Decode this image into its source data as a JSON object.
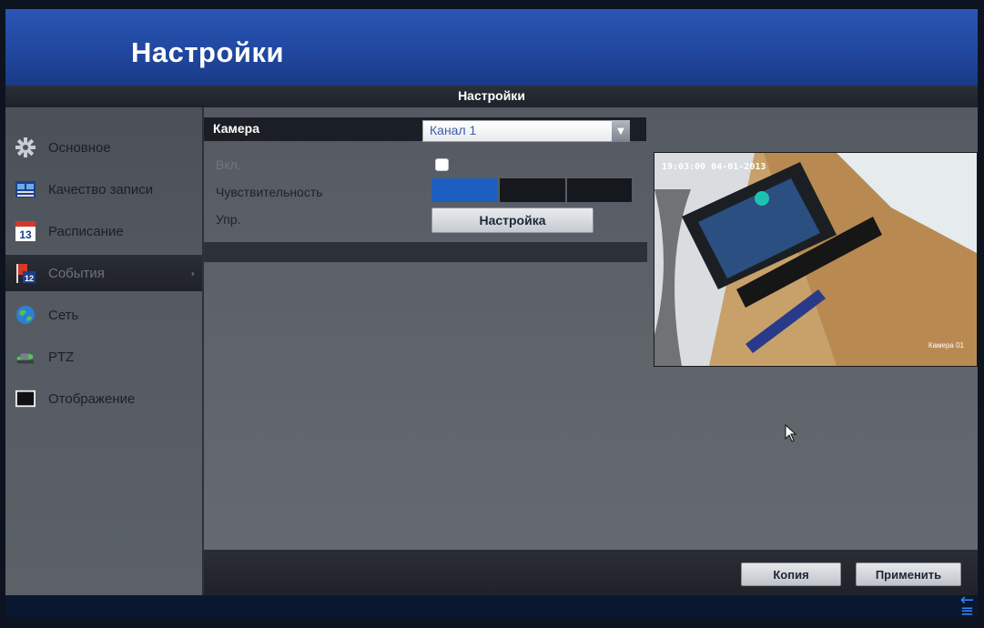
{
  "app": {
    "title": "Настройки"
  },
  "header": {
    "section_title": "Настройки"
  },
  "sidebar": {
    "items": [
      {
        "label": "Основное",
        "icon": "gear-icon"
      },
      {
        "label": "Качество записи",
        "icon": "film-icon"
      },
      {
        "label": "Расписание",
        "icon": "calendar-icon"
      },
      {
        "label": "События",
        "icon": "event-flag-icon",
        "active": true
      },
      {
        "label": "Сеть",
        "icon": "globe-icon"
      },
      {
        "label": "PTZ",
        "icon": "ptz-icon"
      },
      {
        "label": "Отображение",
        "icon": "monitor-icon"
      }
    ],
    "calendar_day": "13",
    "event_day": "12"
  },
  "form": {
    "camera_label": "Камера",
    "camera_value": "Канал 1",
    "enable_label": "Вкл.",
    "sensitivity_label": "Чувствительность",
    "control_label": "Упр.",
    "setup_button": "Настройка"
  },
  "preview": {
    "timestamp": "19:03:00 04-01-2013",
    "camera_name": "Камера 01"
  },
  "actions": {
    "copy": "Копия",
    "apply": "Применить"
  },
  "colors": {
    "accent": "#1d5fc0",
    "title_bar": "#2148a0"
  }
}
